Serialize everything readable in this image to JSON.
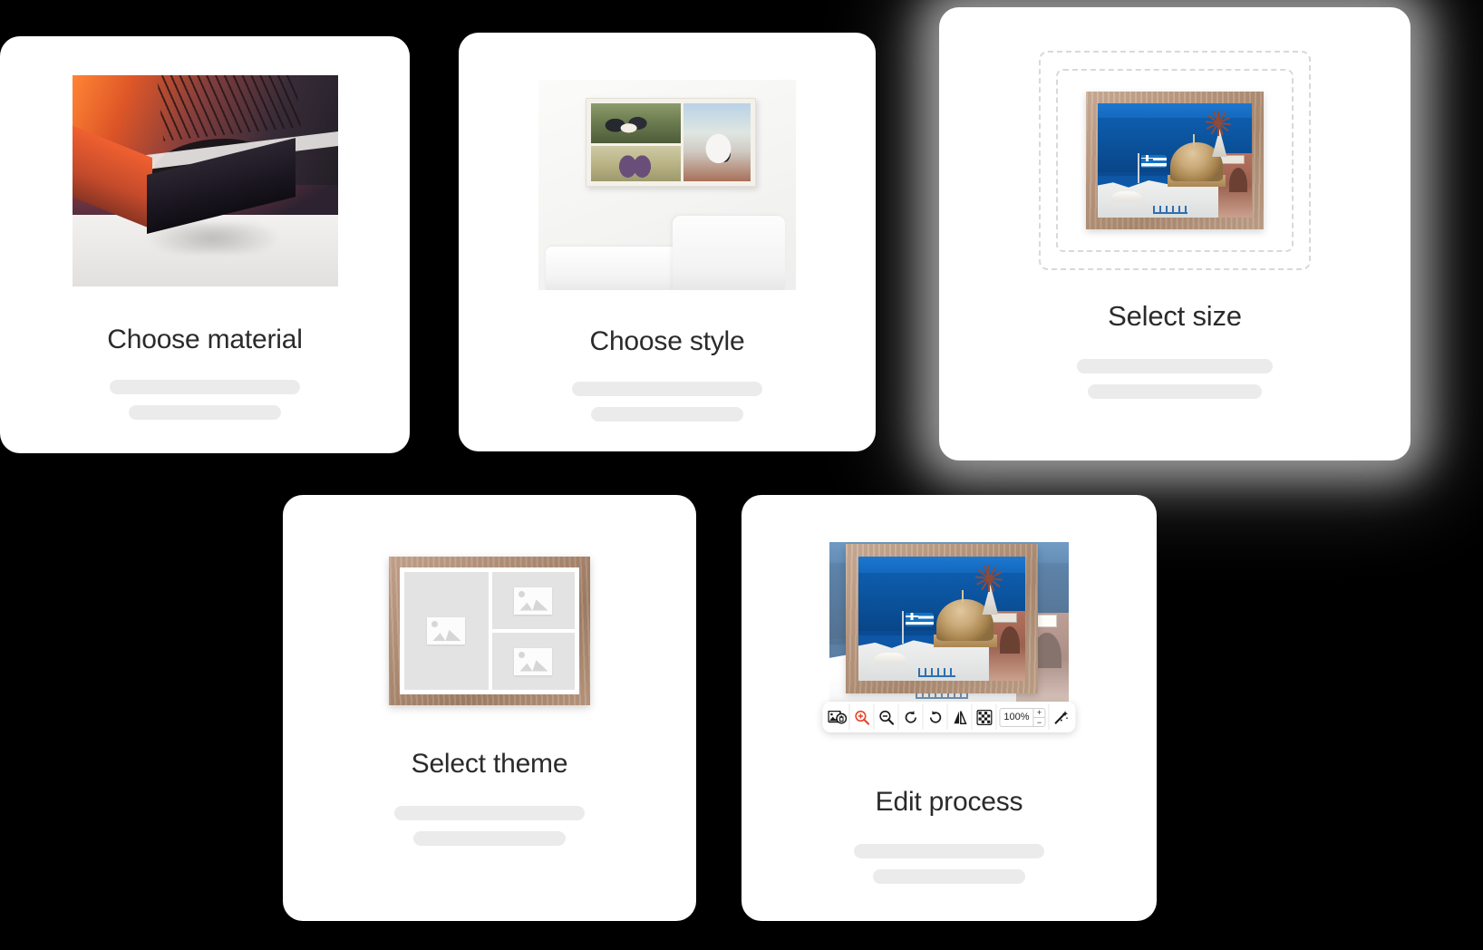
{
  "background_color": "#000000",
  "card_color": "#ffffff",
  "title_color": "#2b2b2b",
  "placeholder_color": "#ebebeb",
  "accent_color": "#e8452a",
  "cards": [
    {
      "id": "choose-material",
      "title": "Choose material",
      "media": "canvas-corner-photo",
      "elevated": false
    },
    {
      "id": "choose-style",
      "title": "Choose style",
      "media": "room-wall-canvas-collage",
      "elevated": false
    },
    {
      "id": "select-size",
      "title": "Select size",
      "media": "framed-photo-with-size-guides",
      "elevated": true
    },
    {
      "id": "select-theme",
      "title": "Select theme",
      "media": "wooden-frame-layout-placeholders",
      "elevated": false
    },
    {
      "id": "edit-process",
      "title": "Edit process",
      "media": "framed-photo-with-editor-toolbar",
      "elevated": false
    }
  ],
  "editor_toolbar": {
    "buttons": [
      {
        "name": "delete-image-icon",
        "label": "Delete image",
        "active": false
      },
      {
        "name": "zoom-in-icon",
        "label": "Zoom in",
        "active": true
      },
      {
        "name": "zoom-out-icon",
        "label": "Zoom out",
        "active": false
      },
      {
        "name": "rotate-left-icon",
        "label": "Rotate left",
        "active": false
      },
      {
        "name": "rotate-right-icon",
        "label": "Rotate right",
        "active": false
      },
      {
        "name": "flip-horizontal-icon",
        "label": "Flip horizontal",
        "active": false
      },
      {
        "name": "transparency-icon",
        "label": "Transparency",
        "active": false
      },
      {
        "name": "magic-wand-icon",
        "label": "Auto enhance",
        "active": false
      }
    ],
    "zoom_value": "100%",
    "stepper_increase": "+",
    "stepper_decrease": "−"
  }
}
